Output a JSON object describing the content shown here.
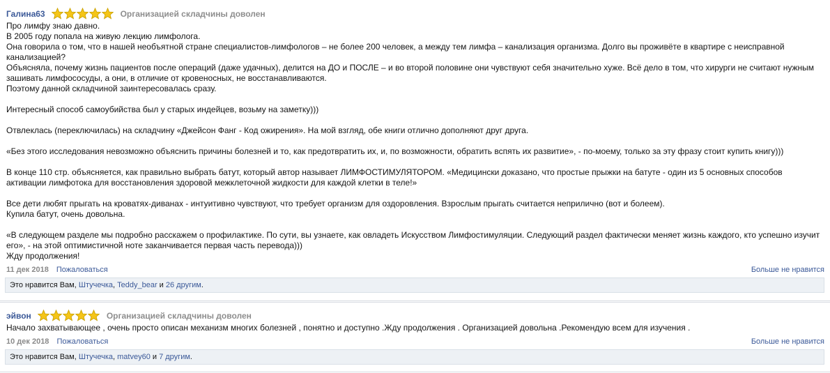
{
  "reviews": [
    {
      "author": "Галина63",
      "rating": 5,
      "status": "Организацией складчины доволен",
      "text": "Про лимфу знаю давно.\nВ 2005 году попала на живую лекцию лимфолога.\nОна говорила о том, что в нашей необъятной стране специалистов-лимфологов – не более 200 человек, а между тем лимфа – канализация организма. Долго вы проживёте в квартире с неисправной канализацией?\nОбъясняла, почему жизнь пациентов после операций (даже удачных), делится на ДО и ПОСЛЕ – и во второй половине они чувствуют себя значительно хуже. Всё дело в том, что хирурги не считают нужным зашивать лимфососуды, а они, в отличие от кровеносных, не восстанавливаются.\nПоэтому данной складчиной заинтересовалась сразу.\n\nИнтересный способ самоубийства был у старых индейцев, возьму на заметку)))\n\nОтвлеклась (переключилась) на складчину «Джейсон Фанг - Код ожирения». На мой взгляд, обе книги отлично дополняют друг друга.\n\n«Без этого исследования невозможно объяснить причины болезней и то, как предотвратить их, и, по возможности, обратить вспять их развитие», - по-моему, только за эту фразу стоит купить книгу)))\n\nВ конце 110 стр. объясняется, как правильно выбрать батут, который автор называет ЛИМФОСТИМУЛЯТОРОМ. «Медицински доказано, что простые прыжки на батуте - один из 5 основных способов активации лимфотока для восстановления здоровой межклеточной жидкости для каждой клетки в теле!»\n\nВсе дети любят прыгать на кроватях-диванах - интуитивно чувствуют, что требует организм для оздоровления. Взрослым прыгать считается неприлично (вот и болеем).\nКупила батут, очень довольна.\n\n«В следующем разделе мы подробно расскажем о профилактике. По сути, вы узнаете, как овладеть Искусством Лимфостимуляции. Следующий раздел фактически меняет жизнь каждого, кто успешно изучит его», - на этой оптимистичной ноте заканчивается первая часть перевода)))\nЖду продолжения!",
      "date": "11 дек 2018",
      "complain_label": "Пожаловаться",
      "unlike_label": "Больше не нравится",
      "likes_prefix": "Это нравится Вам, ",
      "liker1": "Штучечка",
      "sep1": ", ",
      "liker2": "Teddy_bear",
      "sep2": " и ",
      "others": "26 другим",
      "likes_suffix": "."
    },
    {
      "author": "эйвон",
      "rating": 5,
      "status": "Организацией складчины доволен",
      "text": "Начало захватывающее , очень просто описан механизм многих болезней , понятно и доступно .Жду продолжения . Организацией довольна .Рекомендую всем для изучения .",
      "date": "10 дек 2018",
      "complain_label": "Пожаловаться",
      "unlike_label": "Больше не нравится",
      "likes_prefix": "Это нравится Вам, ",
      "liker1": "Штучечка",
      "sep1": ", ",
      "liker2": "matvey60",
      "sep2": " и ",
      "others": "7 другим",
      "likes_suffix": "."
    }
  ],
  "colors": {
    "link": "#3b5998",
    "star_fill": "#f5c518",
    "star_stroke": "#c8a000",
    "likes_bg": "#edf1f5"
  },
  "icons": {
    "rating_star": "star-icon"
  }
}
